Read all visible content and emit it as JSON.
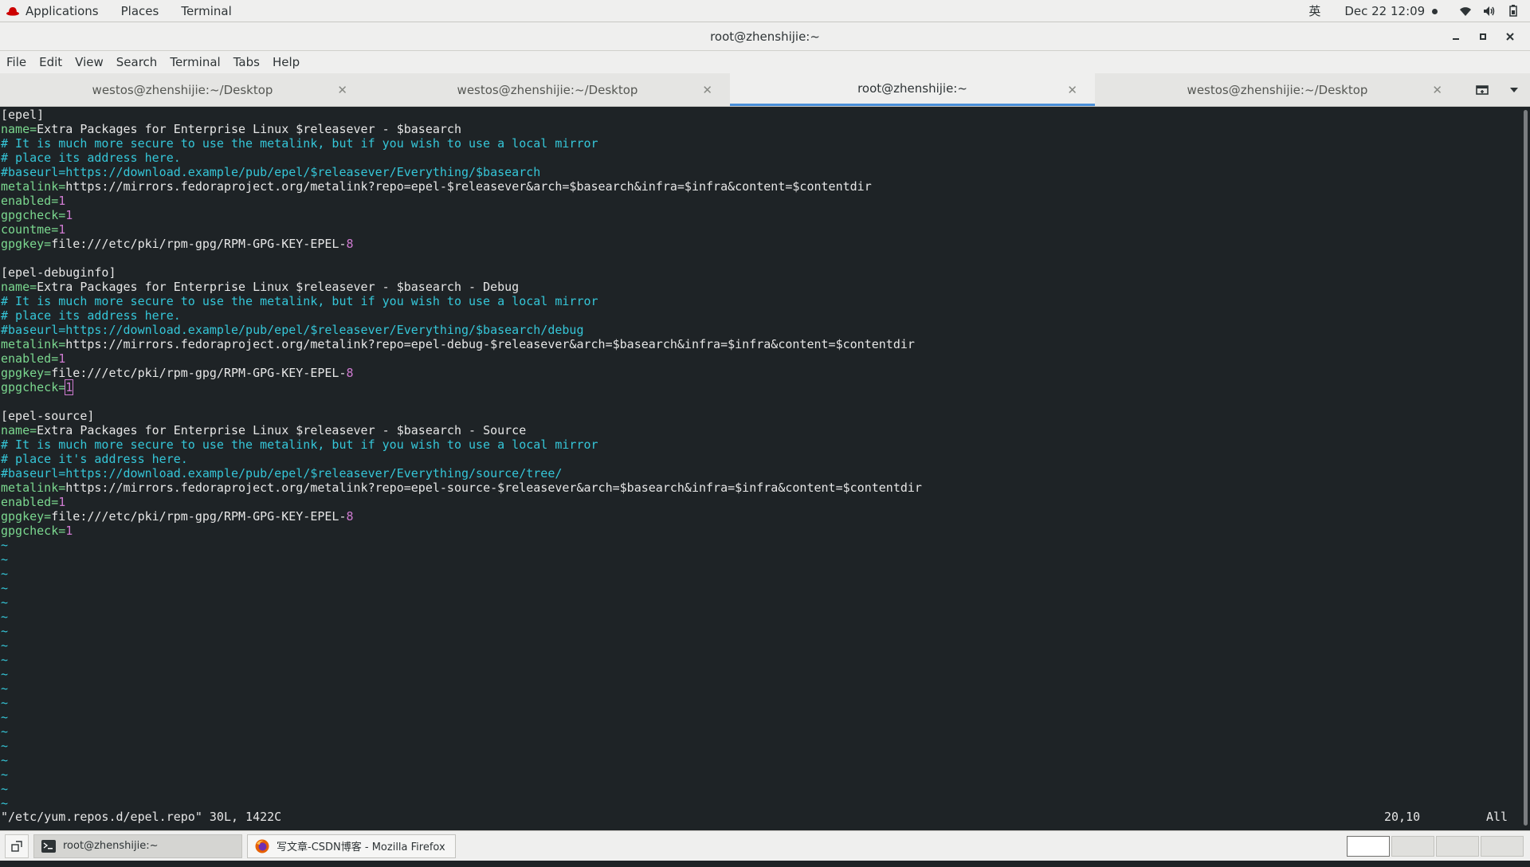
{
  "top_bar": {
    "applications": "Applications",
    "places": "Places",
    "terminal": "Terminal",
    "input_method": "英",
    "datetime": "Dec 22  12:09"
  },
  "window": {
    "title": "root@zhenshijie:~"
  },
  "menu": [
    "File",
    "Edit",
    "View",
    "Search",
    "Terminal",
    "Tabs",
    "Help"
  ],
  "tabs": [
    {
      "label": "westos@zhenshijie:~/Desktop",
      "active": false
    },
    {
      "label": "westos@zhenshijie:~/Desktop",
      "active": false
    },
    {
      "label": "root@zhenshijie:~",
      "active": true
    },
    {
      "label": "westos@zhenshijie:~/Desktop",
      "active": false
    }
  ],
  "terminal_lines": [
    [
      {
        "t": "[epel]",
        "c": "text"
      }
    ],
    [
      {
        "t": "name=",
        "c": "key"
      },
      {
        "t": "Extra Packages for Enterprise Linux $releasever - $basearch",
        "c": "text"
      }
    ],
    [
      {
        "t": "# It is much more secure to use the metalink, but if you wish to use a local mirror",
        "c": "comment"
      }
    ],
    [
      {
        "t": "# place its address here.",
        "c": "comment"
      }
    ],
    [
      {
        "t": "#baseurl=https://download.example/pub/epel/$releasever/Everything/$basearch",
        "c": "comment"
      }
    ],
    [
      {
        "t": "metalink=",
        "c": "key"
      },
      {
        "t": "https://mirrors.fedoraproject.org/metalink?repo=epel-$releasever&arch=$basearch&infra=$infra&content=$contentdir",
        "c": "text"
      }
    ],
    [
      {
        "t": "enabled=",
        "c": "key"
      },
      {
        "t": "1",
        "c": "num"
      }
    ],
    [
      {
        "t": "gpgcheck=",
        "c": "key"
      },
      {
        "t": "1",
        "c": "num"
      }
    ],
    [
      {
        "t": "countme=",
        "c": "key"
      },
      {
        "t": "1",
        "c": "num"
      }
    ],
    [
      {
        "t": "gpgkey=",
        "c": "key"
      },
      {
        "t": "file:///etc/pki/rpm-gpg/RPM-GPG-KEY-EPEL-",
        "c": "text"
      },
      {
        "t": "8",
        "c": "num"
      }
    ],
    [],
    [
      {
        "t": "[epel-debuginfo]",
        "c": "text"
      }
    ],
    [
      {
        "t": "name=",
        "c": "key"
      },
      {
        "t": "Extra Packages for Enterprise Linux $releasever - $basearch - Debug",
        "c": "text"
      }
    ],
    [
      {
        "t": "# It is much more secure to use the metalink, but if you wish to use a local mirror",
        "c": "comment"
      }
    ],
    [
      {
        "t": "# place its address here.",
        "c": "comment"
      }
    ],
    [
      {
        "t": "#baseurl=https://download.example/pub/epel/$releasever/Everything/$basearch/debug",
        "c": "comment"
      }
    ],
    [
      {
        "t": "metalink=",
        "c": "key"
      },
      {
        "t": "https://mirrors.fedoraproject.org/metalink?repo=epel-debug-$releasever&arch=$basearch&infra=$infra&content=$contentdir",
        "c": "text"
      }
    ],
    [
      {
        "t": "enabled=",
        "c": "key"
      },
      {
        "t": "1",
        "c": "num"
      }
    ],
    [
      {
        "t": "gpgkey=",
        "c": "key"
      },
      {
        "t": "file:///etc/pki/rpm-gpg/RPM-GPG-KEY-EPEL-",
        "c": "text"
      },
      {
        "t": "8",
        "c": "num"
      }
    ],
    [
      {
        "t": "gpgcheck=",
        "c": "key"
      },
      {
        "t": "1",
        "c": "num",
        "cursor": true
      }
    ],
    [],
    [
      {
        "t": "[epel-source]",
        "c": "text"
      }
    ],
    [
      {
        "t": "name=",
        "c": "key"
      },
      {
        "t": "Extra Packages for Enterprise Linux $releasever - $basearch - Source",
        "c": "text"
      }
    ],
    [
      {
        "t": "# It is much more secure to use the metalink, but if you wish to use a local mirror",
        "c": "comment"
      }
    ],
    [
      {
        "t": "# place it's address here.",
        "c": "comment"
      }
    ],
    [
      {
        "t": "#baseurl=https://download.example/pub/epel/$releasever/Everything/source/tree/",
        "c": "comment"
      }
    ],
    [
      {
        "t": "metalink=",
        "c": "key"
      },
      {
        "t": "https://mirrors.fedoraproject.org/metalink?repo=epel-source-$releasever&arch=$basearch&infra=$infra&content=$contentdir",
        "c": "text"
      }
    ],
    [
      {
        "t": "enabled=",
        "c": "key"
      },
      {
        "t": "1",
        "c": "num"
      }
    ],
    [
      {
        "t": "gpgkey=",
        "c": "key"
      },
      {
        "t": "file:///etc/pki/rpm-gpg/RPM-GPG-KEY-EPEL-",
        "c": "text"
      },
      {
        "t": "8",
        "c": "num"
      }
    ],
    [
      {
        "t": "gpgcheck=",
        "c": "key"
      },
      {
        "t": "1",
        "c": "num"
      }
    ]
  ],
  "tilde_count": 19,
  "status": {
    "file_info": "\"/etc/yum.repos.d/epel.repo\" 30L, 1422C",
    "position": "20,10",
    "scroll": "All"
  },
  "taskbar": {
    "tasks": [
      {
        "label": "root@zhenshijie:~",
        "icon": "terminal-icon",
        "active": true
      },
      {
        "label": "写文章-CSDN博客 - Mozilla Firefox",
        "icon": "firefox-icon",
        "active": false
      }
    ],
    "workspace_count": 4,
    "active_workspace": 1
  }
}
